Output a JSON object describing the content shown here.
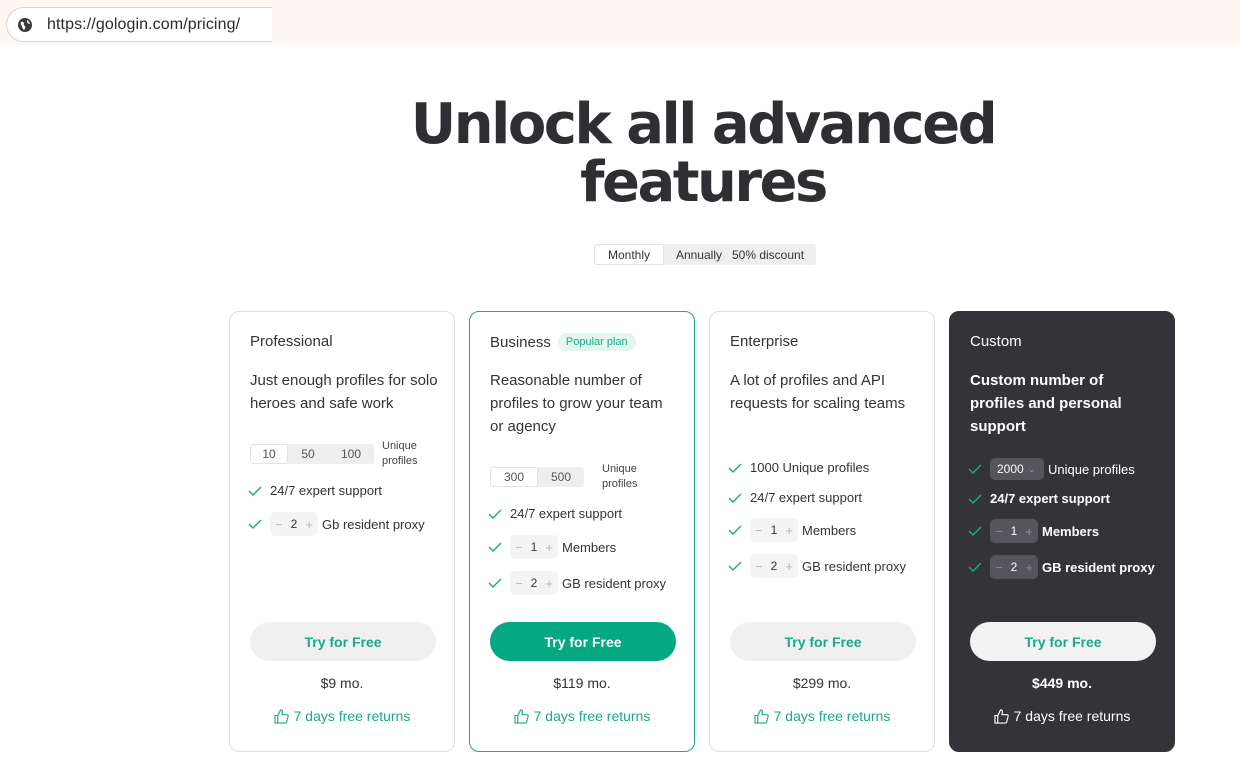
{
  "browser": {
    "url": "https://gologin.com/pricing/"
  },
  "hero": {
    "title": "Unlock all advanced features"
  },
  "billing_toggle": {
    "monthly": "Monthly",
    "annually": "Annually",
    "discount": "50% discount"
  },
  "plans": [
    {
      "name": "Professional",
      "description": "Just enough profiles for solo heroes and safe work",
      "profile_options": [
        "10",
        "50",
        "100"
      ],
      "profile_selected": "10",
      "profiles_label": "Unique profiles",
      "support": "24/7 expert support",
      "proxy_value": "2",
      "proxy_label": "Gb resident proxy",
      "cta": "Try for Free",
      "price": "$9 mo.",
      "returns": "7 days free returns"
    },
    {
      "name": "Business",
      "badge": "Popular plan",
      "description": "Reasonable number of profiles to grow your team or agency",
      "profile_options": [
        "300",
        "500"
      ],
      "profile_selected": "300",
      "profiles_label": "Unique profiles",
      "support": "24/7 expert support",
      "members_value": "1",
      "members_label": "Members",
      "proxy_value": "2",
      "proxy_label": "GB resident proxy",
      "cta": "Try for Free",
      "price": "$119 mo.",
      "returns": "7 days free returns"
    },
    {
      "name": "Enterprise",
      "description": "A lot of profiles and API requests for scaling teams",
      "profiles_text": "1000 Unique profiles",
      "support": "24/7 expert support",
      "members_value": "1",
      "members_label": "Members",
      "proxy_value": "2",
      "proxy_label": "GB resident proxy",
      "cta": "Try for Free",
      "price": "$299 mo.",
      "returns": "7 days free returns"
    },
    {
      "name": "Custom",
      "description": "Custom number of profiles and personal support",
      "profiles_dropdown": "2000",
      "profiles_label": "Unique profiles",
      "support": "24/7 expert support",
      "members_value": "1",
      "members_label": "Members",
      "proxy_value": "2",
      "proxy_label": "GB resident proxy",
      "cta": "Try for Free",
      "price": "$449 mo.",
      "returns": "7 days free returns"
    }
  ],
  "colors": {
    "accent": "#1aaa87",
    "accent_button": "#04a882",
    "dark_card": "#333338"
  },
  "icons": {
    "url": "globe-icon",
    "feature": "check-icon",
    "returns": "thumbs-up-icon",
    "dropdown": "chevron-down-icon"
  }
}
